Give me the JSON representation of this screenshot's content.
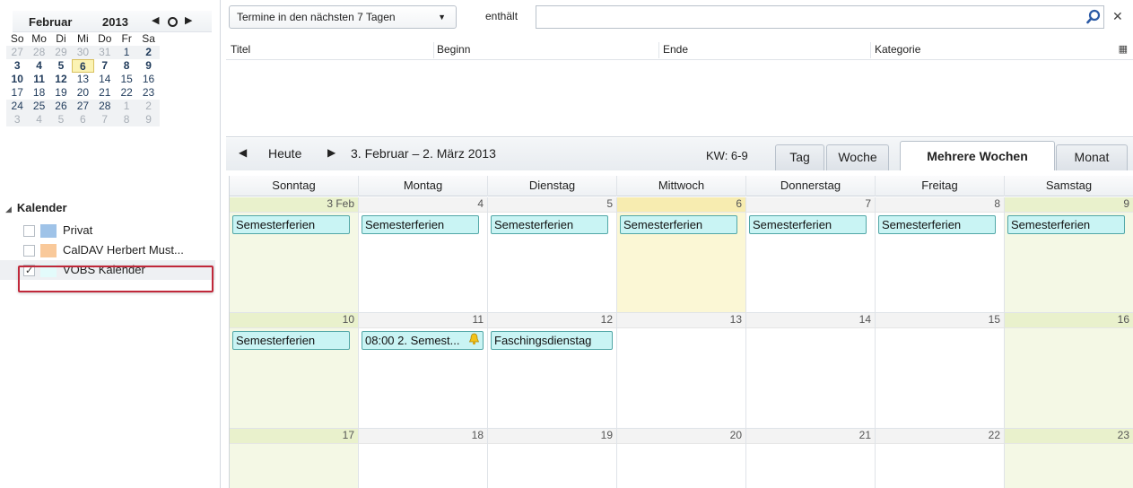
{
  "minical": {
    "month": "Februar",
    "year": "2013",
    "prev_icon": "◀",
    "next_icon": "▶",
    "dow": [
      "So",
      "Mo",
      "Di",
      "Mi",
      "Do",
      "Fr",
      "Sa"
    ],
    "weeks": [
      [
        {
          "d": "27",
          "o": 1
        },
        {
          "d": "28",
          "o": 1
        },
        {
          "d": "29",
          "o": 1
        },
        {
          "d": "30",
          "o": 1
        },
        {
          "d": "31",
          "o": 1
        },
        {
          "d": "1",
          "o": 0
        },
        {
          "d": "2",
          "o": 0,
          "b": 1
        }
      ],
      [
        {
          "d": "3",
          "o": 0,
          "b": 1
        },
        {
          "d": "4",
          "o": 0,
          "b": 1
        },
        {
          "d": "5",
          "o": 0,
          "b": 1
        },
        {
          "d": "6",
          "o": 0,
          "b": 1,
          "t": 1
        },
        {
          "d": "7",
          "o": 0,
          "b": 1
        },
        {
          "d": "8",
          "o": 0,
          "b": 1
        },
        {
          "d": "9",
          "o": 0,
          "b": 1
        }
      ],
      [
        {
          "d": "10",
          "o": 0,
          "b": 1
        },
        {
          "d": "11",
          "o": 0,
          "b": 1
        },
        {
          "d": "12",
          "o": 0,
          "b": 1
        },
        {
          "d": "13",
          "o": 0
        },
        {
          "d": "14",
          "o": 0
        },
        {
          "d": "15",
          "o": 0
        },
        {
          "d": "16",
          "o": 0
        }
      ],
      [
        {
          "d": "17",
          "o": 0
        },
        {
          "d": "18",
          "o": 0
        },
        {
          "d": "19",
          "o": 0
        },
        {
          "d": "20",
          "o": 0
        },
        {
          "d": "21",
          "o": 0
        },
        {
          "d": "22",
          "o": 0
        },
        {
          "d": "23",
          "o": 0
        }
      ],
      [
        {
          "d": "24",
          "o": 0
        },
        {
          "d": "25",
          "o": 0
        },
        {
          "d": "26",
          "o": 0
        },
        {
          "d": "27",
          "o": 0
        },
        {
          "d": "28",
          "o": 0
        },
        {
          "d": "1",
          "o": 1
        },
        {
          "d": "2",
          "o": 1
        }
      ],
      [
        {
          "d": "3",
          "o": 1
        },
        {
          "d": "4",
          "o": 1
        },
        {
          "d": "5",
          "o": 1
        },
        {
          "d": "6",
          "o": 1
        },
        {
          "d": "7",
          "o": 1
        },
        {
          "d": "8",
          "o": 1
        },
        {
          "d": "9",
          "o": 1
        }
      ]
    ]
  },
  "calendars": {
    "header": "Kalender",
    "items": [
      {
        "name": "Privat",
        "color": "#9fc3e8",
        "checked": false
      },
      {
        "name": "CalDAV Herbert Must...",
        "color": "#f9c99a",
        "checked": false
      },
      {
        "name": "VOBS Kalender",
        "color": "#e3fbfb",
        "checked": true
      }
    ]
  },
  "filter": {
    "select_label": "Termine in den nächsten 7 Tagen",
    "contains_label": "enthält",
    "search_value": ""
  },
  "eventlist": {
    "columns": [
      "Titel",
      "Beginn",
      "Ende",
      "Kategorie"
    ]
  },
  "toolbar": {
    "today_label": "Heute",
    "range": "3. Februar – 2. März 2013",
    "kw": "KW: 6-9",
    "tabs": [
      "Tag",
      "Woche",
      "Mehrere Wochen",
      "Monat"
    ],
    "active_tab": "Mehrere Wochen"
  },
  "grid": {
    "days": [
      "Sonntag",
      "Montag",
      "Dienstag",
      "Mittwoch",
      "Donnerstag",
      "Freitag",
      "Samstag"
    ],
    "weeks": [
      [
        {
          "n": "3 Feb",
          "w": 1,
          "ev": "Semesterferien"
        },
        {
          "n": "4",
          "ev": "Semesterferien"
        },
        {
          "n": "5",
          "ev": "Semesterferien"
        },
        {
          "n": "6",
          "t": 1,
          "ev": "Semesterferien"
        },
        {
          "n": "7",
          "ev": "Semesterferien"
        },
        {
          "n": "8",
          "ev": "Semesterferien"
        },
        {
          "n": "9",
          "w": 1,
          "ev": "Semesterferien"
        }
      ],
      [
        {
          "n": "10",
          "w": 1,
          "ev": "Semesterferien"
        },
        {
          "n": "11",
          "ev": "08:00 2. Semest...",
          "bell": 1
        },
        {
          "n": "12",
          "ev": "Faschingsdienstag"
        },
        {
          "n": "13"
        },
        {
          "n": "14"
        },
        {
          "n": "15"
        },
        {
          "n": "16",
          "w": 1
        }
      ],
      [
        {
          "n": "17",
          "w": 1
        },
        {
          "n": "18"
        },
        {
          "n": "19"
        },
        {
          "n": "20"
        },
        {
          "n": "21"
        },
        {
          "n": "22"
        },
        {
          "n": "23",
          "w": 1
        }
      ]
    ]
  }
}
